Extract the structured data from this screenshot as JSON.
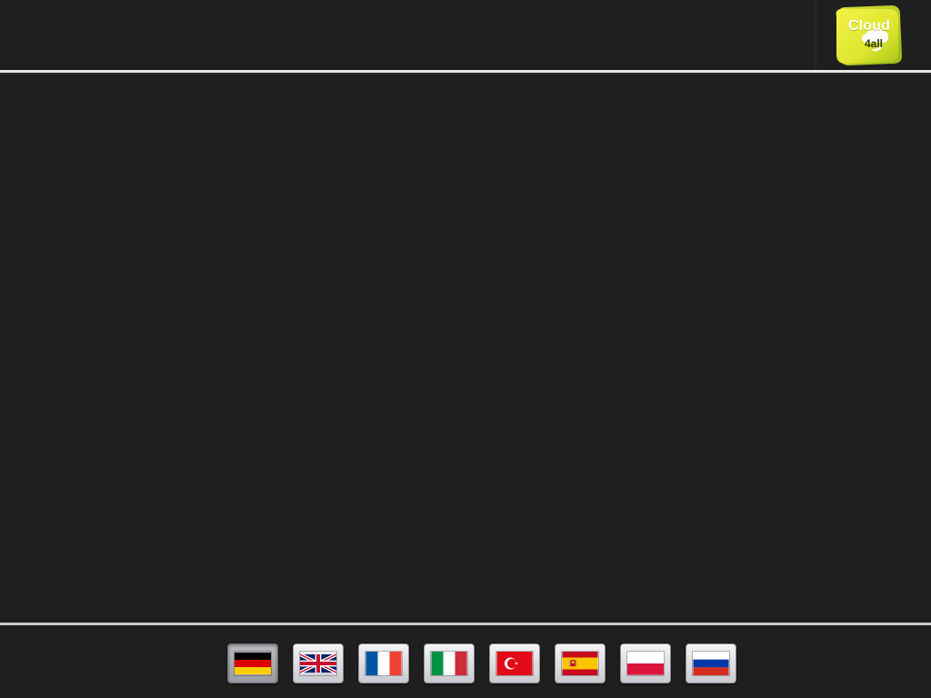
{
  "logo": {
    "line1": "Cloud",
    "line2": "4all",
    "colors": {
      "leaf_light": "#e9ee3a",
      "leaf_dark": "#a9c81a",
      "text": "#ffffff"
    }
  },
  "colors": {
    "background": "#1f1f1f",
    "rule_top": "#e6e6e6",
    "rule_bottom": "#c9c9c9"
  },
  "languages": [
    {
      "code": "de",
      "icon": "flag-germany-icon",
      "selected": true
    },
    {
      "code": "en",
      "icon": "flag-united-kingdom-icon",
      "selected": false
    },
    {
      "code": "fr",
      "icon": "flag-france-icon",
      "selected": false
    },
    {
      "code": "it",
      "icon": "flag-italy-icon",
      "selected": false
    },
    {
      "code": "tr",
      "icon": "flag-turkey-icon",
      "selected": false
    },
    {
      "code": "es",
      "icon": "flag-spain-icon",
      "selected": false
    },
    {
      "code": "pl",
      "icon": "flag-poland-icon",
      "selected": false
    },
    {
      "code": "ru",
      "icon": "flag-russia-icon",
      "selected": false
    }
  ]
}
